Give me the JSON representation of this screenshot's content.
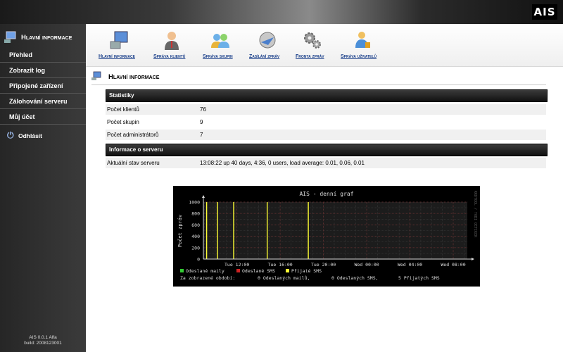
{
  "app": {
    "logo": "AIS"
  },
  "sidebar": {
    "header": "Hlavní informace",
    "items": [
      {
        "label": "Přehled"
      },
      {
        "label": "Zobrazit log"
      },
      {
        "label": "Připojené zařízení"
      },
      {
        "label": "Zálohování serveru"
      },
      {
        "label": "Můj účet"
      }
    ],
    "logout": "Odhlásit",
    "version": "AIS 0.0.1 Alfa",
    "build": "build: 2008123001"
  },
  "toolbar": {
    "items": [
      {
        "label": "Hlavní informace",
        "icon": "monitor-icon"
      },
      {
        "label": "Správa klientů",
        "icon": "user-icon"
      },
      {
        "label": "Správa skupin",
        "icon": "group-icon"
      },
      {
        "label": "Zasílání zpráv",
        "icon": "send-icon"
      },
      {
        "label": "Fronta zpráv",
        "icon": "gears-icon"
      },
      {
        "label": "Správa uživatelů",
        "icon": "users-icon"
      }
    ]
  },
  "page": {
    "title": "Hlavní informace",
    "stats": {
      "heading": "Statistiky",
      "rows": [
        {
          "label": "Počet klientů",
          "value": "76"
        },
        {
          "label": "Počet skupin",
          "value": "9"
        },
        {
          "label": "Počet administrátorů",
          "value": "7"
        }
      ]
    },
    "server": {
      "heading": "Informace o serveru",
      "rows": [
        {
          "label": "Aktuální stav serveru",
          "value": "13:08:22 up 40 days, 4:36, 0 users, load average: 0.01, 0.06, 0.01"
        }
      ]
    }
  },
  "chart_data": {
    "type": "bar",
    "title": "AIS - denní graf",
    "ylabel": "Počet zpráv",
    "side_label": "RRDTOOL / TOBI OETIKER",
    "ylim": [
      0,
      1000
    ],
    "y_ticks": [
      0,
      200,
      400,
      600,
      800,
      1000
    ],
    "x_ticks": [
      "Tue 12:00",
      "Tue 16:00",
      "Tue 20:00",
      "Wed 00:00",
      "Wed 04:00",
      "Wed 08:00"
    ],
    "x_tick_positions_hours": [
      12,
      16,
      20,
      24,
      28,
      32
    ],
    "x_range_hours": [
      8.9,
      33.3
    ],
    "grid": true,
    "series": [
      {
        "name": "Odeslané maily",
        "color": "#33cc33",
        "spikes_hours": []
      },
      {
        "name": "Odeslané SMS",
        "color": "#cc2222",
        "spikes_hours": []
      },
      {
        "name": "Přijaté SMS",
        "color": "#ffff33",
        "spikes_hours": [
          9.2,
          10.2,
          11.7,
          14.8,
          18.6
        ],
        "spike_value": 1000
      }
    ],
    "summary": {
      "label": "Za zobrazené období:",
      "sent_mails": "0 Odeslaných mailů,",
      "sent_sms": "0 Odeslaných SMS,",
      "received_sms": "5 Přijatých SMS"
    }
  }
}
